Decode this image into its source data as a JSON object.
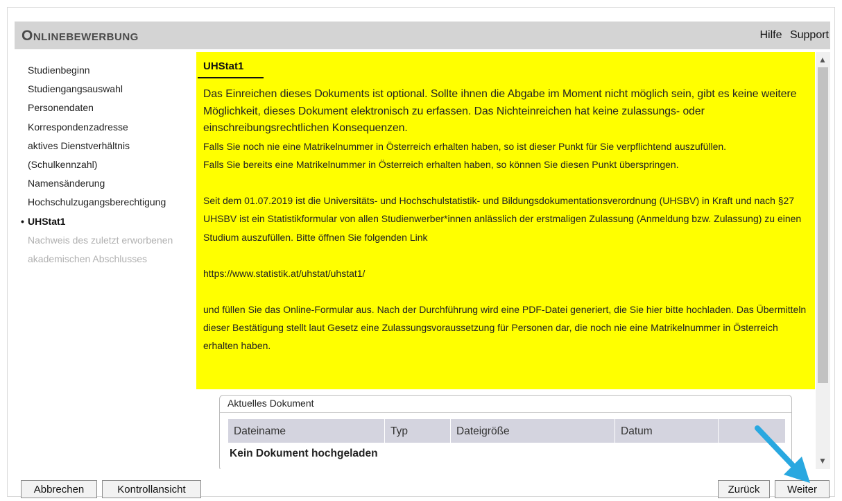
{
  "header": {
    "title": "Onlinebewerbung",
    "links": [
      "Hilfe",
      "Support"
    ]
  },
  "sidebar": {
    "items": [
      {
        "label": "Studienbeginn",
        "state": "normal"
      },
      {
        "label": "Studiengangsauswahl",
        "state": "normal"
      },
      {
        "label": "Personendaten",
        "state": "normal"
      },
      {
        "label": "Korrespondenzadresse",
        "state": "normal"
      },
      {
        "label": "aktives Dienstverhältnis",
        "state": "normal"
      },
      {
        "label": "(Schulkennzahl)",
        "state": "normal"
      },
      {
        "label": "Namensänderung",
        "state": "normal"
      },
      {
        "label": "Hochschulzugangsberechtigung",
        "state": "normal"
      },
      {
        "label": "UHStat1",
        "state": "active",
        "bullet": "•"
      },
      {
        "label": "Nachweis des zuletzt erworbenen",
        "state": "disabled"
      },
      {
        "label": "akademischen Abschlusses",
        "state": "disabled"
      }
    ]
  },
  "content": {
    "heading": "UHStat1",
    "para1": "Das Einreichen dieses Dokuments ist optional. Sollte ihnen die Abgabe im Moment nicht möglich sein, gibt es keine weitere Möglichkeit, dieses Dokument elektronisch zu erfassen. Das Nichteinreichen hat keine zulassungs- oder einschreibungsrechtlichen Konsequenzen.",
    "para2": "Falls Sie noch nie eine Matrikelnummer in Österreich erhalten haben, so ist dieser Punkt für Sie verpflichtend auszufüllen.",
    "para3": "Falls Sie bereits eine Matrikelnummer in Österreich erhalten haben, so können Sie diesen Punkt überspringen.",
    "para4": "Seit dem 01.07.2019 ist die Universitäts- und Hochschulstatistik- und Bildungsdokumentationsverordnung (UHSBV) in Kraft und nach §27 UHSBV ist ein Statistikformular von allen Studienwerber*innen anlässlich der erstmaligen Zulassung (Anmeldung bzw. Zulassung) zu einen Studium auszufüllen. Bitte öffnen Sie folgenden Link",
    "link": "https://www.statistik.at/uhstat/uhstat1/",
    "para5": "und füllen Sie das Online-Formular aus. Nach der Durchführung wird eine PDF-Datei generiert, die Sie hier bitte hochladen. Das Übermitteln dieser Bestätigung stellt laut Gesetz eine Zulassungsvoraussetzung für Personen dar, die noch nie eine Matrikelnummer in Österreich erhalten haben."
  },
  "document": {
    "title": "Aktuelles Dokument",
    "columns": [
      "Dateiname",
      "Typ",
      "Dateigröße",
      "Datum",
      ""
    ],
    "empty_message": "Kein Dokument hochgeladen"
  },
  "buttons": {
    "cancel": "Abbrechen",
    "control_view": "Kontrollansicht",
    "back": "Zurück",
    "next": "Weiter"
  },
  "colors": {
    "highlight": "#ffff00",
    "header_bg": "#d4d4d4",
    "table_header_bg": "#d4d4df",
    "annotation_arrow": "#29a8e0"
  },
  "icons": {
    "scroll_up": "▲",
    "scroll_down": "▼"
  }
}
